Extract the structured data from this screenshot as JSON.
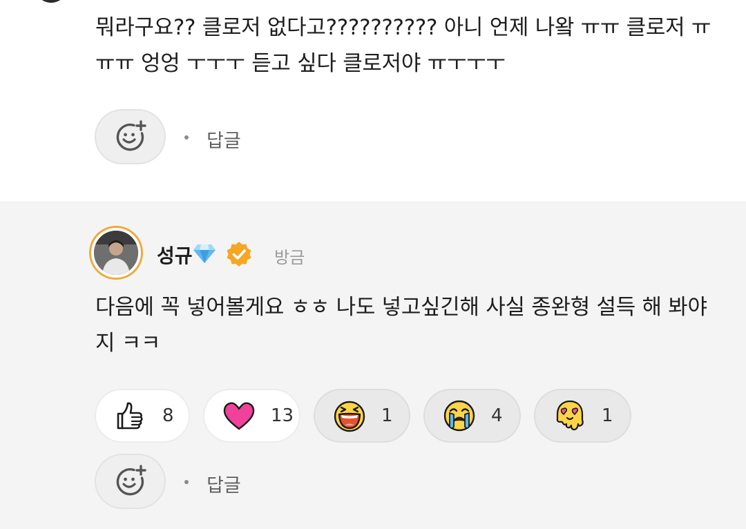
{
  "top_comment": {
    "text": "뭐라구요?? 클로저 없다고?????????? 아니 언제 나왘 ㅠㅠ 클로저 ㅠㅠㅠ 엉엉 ㅜㅜㅜ 듣고 싶다 클로저야 ㅠㅜㅜㅜ",
    "reply_label": "답글"
  },
  "reply_comment": {
    "author": "성규",
    "timestamp": "방금",
    "text": "다음에 꼭 넣어볼게요 ㅎㅎ 나도 넣고싶긴해 사실 종완형 설득 해 봐야지 ㅋㅋ",
    "reply_label": "답글",
    "reactions": [
      {
        "icon": "thumbs-up-icon",
        "count": "8"
      },
      {
        "icon": "heart-icon",
        "count": "13"
      },
      {
        "icon": "laughing-face-icon",
        "count": "1"
      },
      {
        "icon": "crying-face-icon",
        "count": "4"
      },
      {
        "icon": "heart-eyes-melting-face-icon",
        "count": "1"
      }
    ]
  },
  "colors": {
    "verified_badge": "#f5a623",
    "avatar_ring": "#f0a93b",
    "heart": "#f0419b",
    "emoji_yellow": "#fcd44a",
    "reply_background": "#f4f4f4"
  }
}
